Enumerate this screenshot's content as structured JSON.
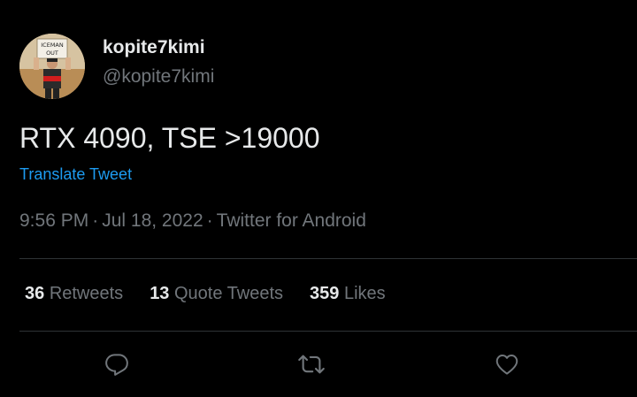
{
  "tweet": {
    "author": {
      "display_name": "kopite7kimi",
      "handle": "@kopite7kimi",
      "avatar_sign_line1": "ICEMAN",
      "avatar_sign_line2": "OUT"
    },
    "text": "RTX 4090, TSE >19000",
    "translate_label": "Translate Tweet",
    "time": "9:56 PM",
    "date": "Jul 18, 2022",
    "source": "Twitter for Android",
    "separator": "·"
  },
  "stats": {
    "retweets_count": "36",
    "retweets_label": "Retweets",
    "quote_tweets_count": "13",
    "quote_tweets_label": "Quote Tweets",
    "likes_count": "359",
    "likes_label": "Likes"
  },
  "actions": [
    {
      "name": "reply",
      "icon": "reply-icon"
    },
    {
      "name": "retweet",
      "icon": "retweet-icon"
    },
    {
      "name": "like",
      "icon": "heart-icon"
    }
  ],
  "colors": {
    "background": "#000000",
    "primary_text": "#e7e9ea",
    "secondary_text": "#71767b",
    "link": "#1d9bf0",
    "divider": "#2f3336"
  }
}
